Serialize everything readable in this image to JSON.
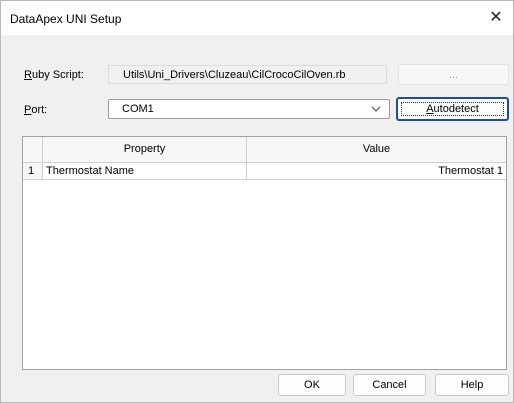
{
  "window": {
    "title": "DataApex UNI Setup",
    "close_glyph": "✕"
  },
  "ruby_script": {
    "label_prefix": "",
    "label_accel": "R",
    "label_rest": "uby Script:",
    "value": "Utils\\Uni_Drivers\\Cluzeau\\CilCrocoCilOven.rb",
    "browse_label": "..."
  },
  "port": {
    "label_accel": "P",
    "label_rest": "ort:",
    "value": "COM1",
    "autodetect_accel": "A",
    "autodetect_rest": "utodetect"
  },
  "table": {
    "headers": [
      "Property",
      "Value"
    ],
    "rows": [
      {
        "index": "1",
        "property": "Thermostat Name",
        "value": "Thermostat 1"
      }
    ]
  },
  "buttons": {
    "ok": "OK",
    "cancel": "Cancel",
    "help": "Help"
  },
  "colors": {
    "dialog_bg": "#f0f0f0",
    "accent_border": "#1f4e9c"
  }
}
